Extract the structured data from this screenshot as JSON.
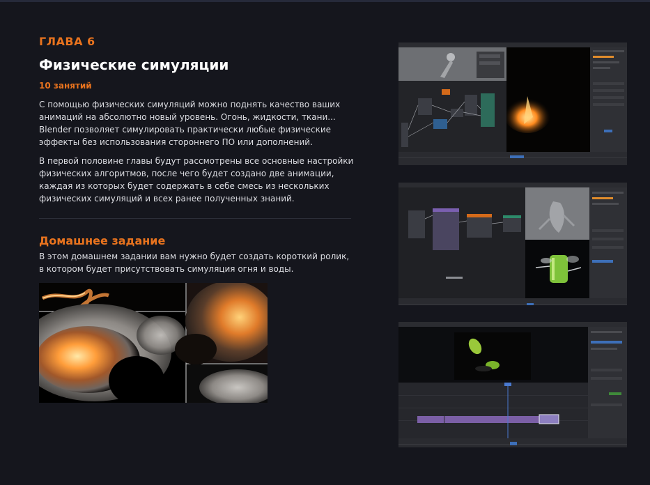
{
  "chapter": "ГЛАВА 6",
  "title": "Физические симуляции",
  "lessons": "10 занятий",
  "paragraphs": [
    "С помощью физических симуляций можно поднять качество ваших анимаций на абсолютно новый уровень. Огонь, жидкости, ткани... Blender позволяет симулировать практически любые физические эффекты без использования стороннего ПО или дополнений.",
    "В первой половине главы будут рассмотрены все основные настройки физических алгоритмов, после чего будет создано две анимации, каждая из которых будет содержать в себе смесь из нескольких физических симуляций и всех ранее полученных знаний."
  ],
  "homework": {
    "title": "Домашнее задание",
    "text": "В этом домашнем задании вам нужно будет создать короткий ролик, в котором будет присутствовать симуляция огня и воды."
  },
  "colors": {
    "background": "#15161d",
    "accent": "#e8731e",
    "text": "#dcdde2",
    "heading": "#ffffff"
  }
}
